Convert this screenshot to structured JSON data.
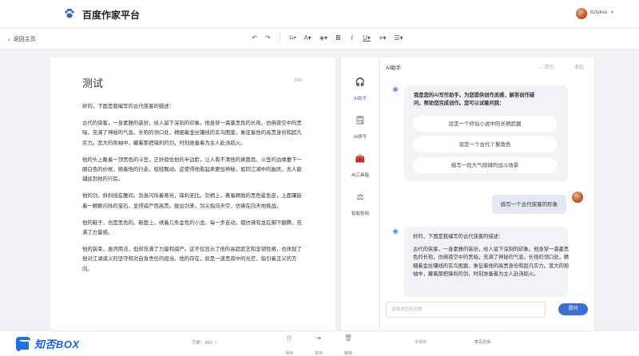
{
  "header": {
    "app_title": "百度作家平台",
    "user_name": "62ryksa",
    "user_caret": "▾"
  },
  "toolbar": {
    "back_label": "返回主页",
    "undo": "↶",
    "redo": "↷",
    "font_size": "11▾",
    "font_color": "A▾",
    "highlight": "◈▾",
    "bold": "B",
    "italic": "I",
    "underline": "U▾",
    "align": "≡▾",
    "list": "☰▾"
  },
  "editor": {
    "title": "测试",
    "counter": "2/30",
    "paragraphs": [
      "好的，下面是我编写的古代侠客的描述：",
      "古代的侠客，一身素雅的装扮，给人留下深刻的印象。他身穿一袭墨黑色的长袍，仿佛夜空中的黑暗，充满了神秘的气息。长袍的领口处，精细着金丝镶线的玄鸟图案，象征着他的高贵身份和超凡实力。宽大的袍袖中，藏着那把锋利的剑，时刻准备着为主人赴汤蹈火。",
      "他的头上戴着一顶黑色的斗笠，正好遮住他的半边脸，让人看不清他的真面目。斗笠的边缘垂下一圈白色的纱帐，随着他的行走，轻轻飘动。这使得他看起来更加神秘，如同江湖中的幽灵，无人能捕捉到他的行踪。",
      "他的剑，斜斜插在腰间。剑身闪烁着寒光，锋利无比。剑柄上，裹着精致的黑色鲨鱼皮，上面镶嵌着一颗颗闪烁的宝石，显得威严而高贵。拔出剑来，剑尖指向天空，仿佛在向天地挑战。",
      "他的鞋子，也是黑色的。鞋面上，绣着几条金色的小龙。每一步走动，都仿佛有龙在脚下翻腾，充满了力量感。",
      "他的装束，虽然简洁，但却充满了力量和威严。这不仅显示了他的高超武艺和坚韧性格，也体现了他对江湖道义的坚守和对自身责任的担当。他的存在，就是一道黑夜中的光芒，指引着正义的方向。"
    ]
  },
  "bottombar": {
    "brand": "知否BOX",
    "word_count": "字数：453 ⓘ",
    "actions": [
      {
        "icon": "🗎",
        "label": "保存"
      },
      {
        "icon": "➔",
        "label": "发布"
      },
      {
        "icon": "🗑",
        "label": "删除"
      }
    ],
    "save_status": "未保存",
    "feedback": "意见反馈"
  },
  "rail": {
    "items": [
      {
        "icon": "🎧",
        "label": "AI助手"
      },
      {
        "icon": "🗒",
        "label": "AI续写"
      },
      {
        "icon": "🧰",
        "label": "AI工具箱"
      },
      {
        "icon": "⚖",
        "label": "智能校阅"
      }
    ]
  },
  "ai": {
    "title": "AI助手",
    "clear_label": "清空",
    "collapse_label": "收起",
    "bot_glyph": "❀",
    "intro": "我是您的AI写作助手，为您提供创作灵感，解答创作疑问，帮助您完成创作。您可以试着问我：",
    "suggestions": [
      "设定一个修仙小说中的长柄武器",
      "设定一个古代丫鬟角色",
      "描写一段大气磅礴的战斗场景"
    ],
    "user_message": "描写一个古代侠客的形象",
    "reply_paragraphs": [
      "好的，下面是我编写的古代侠客的描述：",
      "古代的侠客，一身素雅的装扮，给人留下深刻的印象。他身穿一袭墨黑色的长袍，仿佛夜空中的黑暗，充满了神秘的气息。长袍的领口处，精细着金丝镶线的玄鸟图案，象征着他的高贵身份和超凡实力。宽大的袍袖中，藏着那把锋利的剑，时刻准备着为主人赴汤蹈火。"
    ],
    "input_placeholder": "请描述您的问题",
    "send_label": "提问"
  },
  "colors": {
    "accent": "#3b6fd4",
    "brand_blue": "#1e5fd9",
    "background": "#f0f1f5"
  }
}
